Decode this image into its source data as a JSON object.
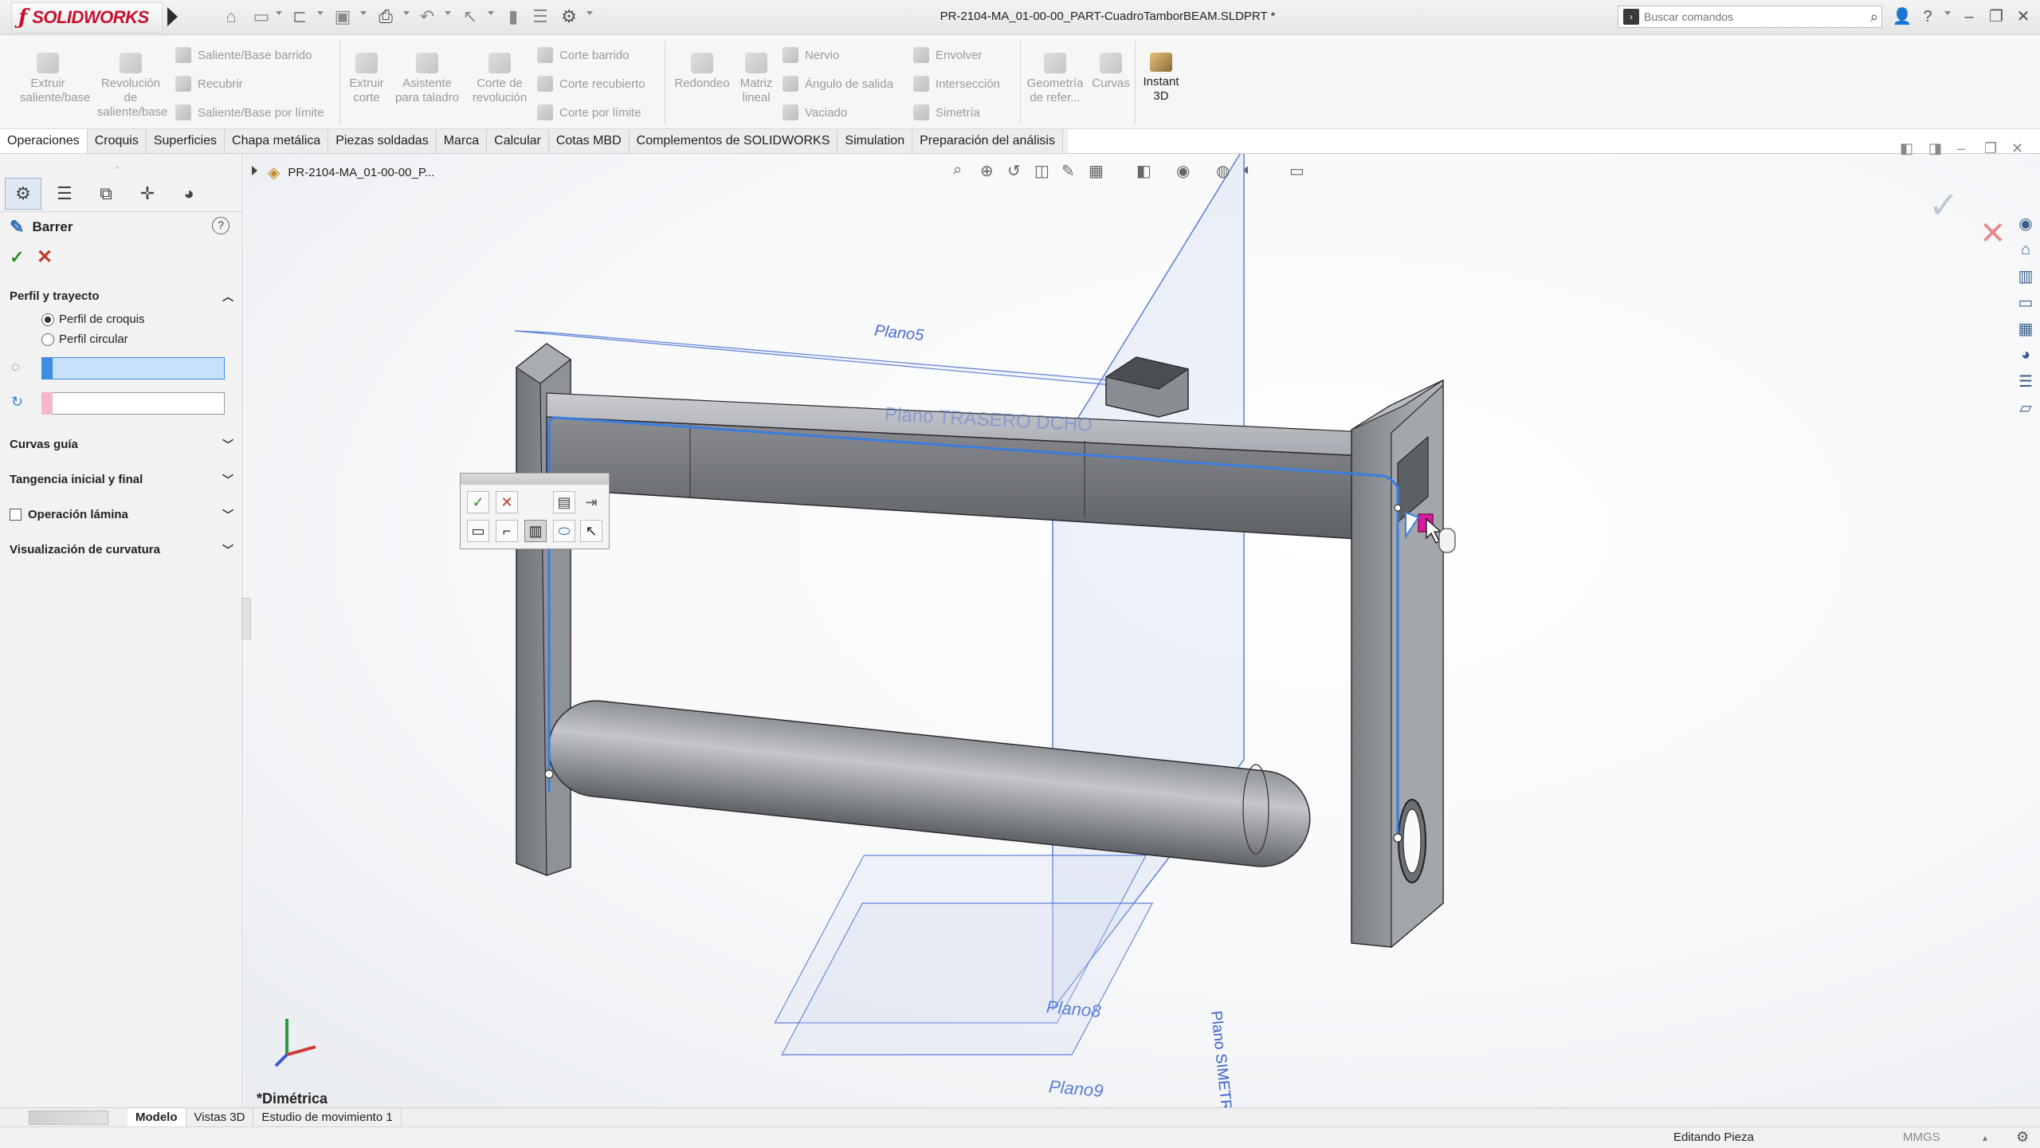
{
  "app": {
    "brand": "SOLIDWORKS",
    "brand_color": "#c8102e",
    "document_title": "PR-2104-MA_01-00-00_PART-CuadroTamborBEAM.SLDPRT *"
  },
  "search": {
    "placeholder": "Buscar comandos"
  },
  "commands": {
    "extrude_boss": "Extruir saliente/base",
    "revolve_boss": "Revolución de saliente/base",
    "swept_boss": "Saliente/Base barrido",
    "lofted_boss": "Recubrir",
    "boundary_boss": "Saliente/Base por límite",
    "extrude_cut": "Extruir corte",
    "hole_wizard": "Asistente para taladro",
    "revolve_cut": "Corte de revolución",
    "swept_cut": "Corte barrido",
    "lofted_cut": "Corte recubierto",
    "boundary_cut": "Corte por límite",
    "fillet": "Redondeo",
    "linear_pattern": "Matriz lineal",
    "rib": "Nervio",
    "draft": "Ángulo de salida",
    "shell": "Vaciado",
    "wrap": "Envolver",
    "intersect": "Intersección",
    "mirror": "Simetría",
    "ref_geometry": "Geometría de refer...",
    "curves": "Curvas",
    "instant3d": "Instant 3D"
  },
  "tabs": [
    "Operaciones",
    "Croquis",
    "Superficies",
    "Chapa metálica",
    "Piezas soldadas",
    "Marca",
    "Calcular",
    "Cotas MBD",
    "Complementos de SOLIDWORKS",
    "Simulation",
    "Preparación del análisis"
  ],
  "active_tab": "Operaciones",
  "feature_tree": {
    "root_label": "PR-2104-MA_01-00-00_P..."
  },
  "property_manager": {
    "title": "Barrer",
    "groups": {
      "profile_path": "Perfil y trayecto",
      "guide_curves": "Curvas guía",
      "tangency": "Tangencia inicial y final",
      "thin_feature": "Operación lámina",
      "curvature": "Visualización de curvatura"
    },
    "options": {
      "sketch_profile": "Perfil de croquis",
      "circular_profile": "Perfil circular"
    },
    "selected_option": "Perfil de croquis",
    "profile_value": "",
    "path_value": "",
    "thin_feature_checked": false
  },
  "model": {
    "plane_top": "Plano5",
    "plane_back": "Plano TRASERO DCHO",
    "plane_left_bottom": "Plano8",
    "plane_bottom": "Plano9",
    "plane_symmetry": "Plano SIMETRIA-YZ"
  },
  "view": {
    "name": "*Dimétrica"
  },
  "bottom_tabs": [
    "Modelo",
    "Vistas 3D",
    "Estudio de movimiento 1"
  ],
  "active_bottom_tab": "Modelo",
  "status": {
    "mode": "Editando Pieza",
    "units": "MMGS"
  },
  "colors": {
    "selection_blue": "#3d8de0",
    "path_pink": "#d81b9a",
    "sketch_blue": "#3a7de0",
    "plane_blue": "#5a7fd6"
  }
}
